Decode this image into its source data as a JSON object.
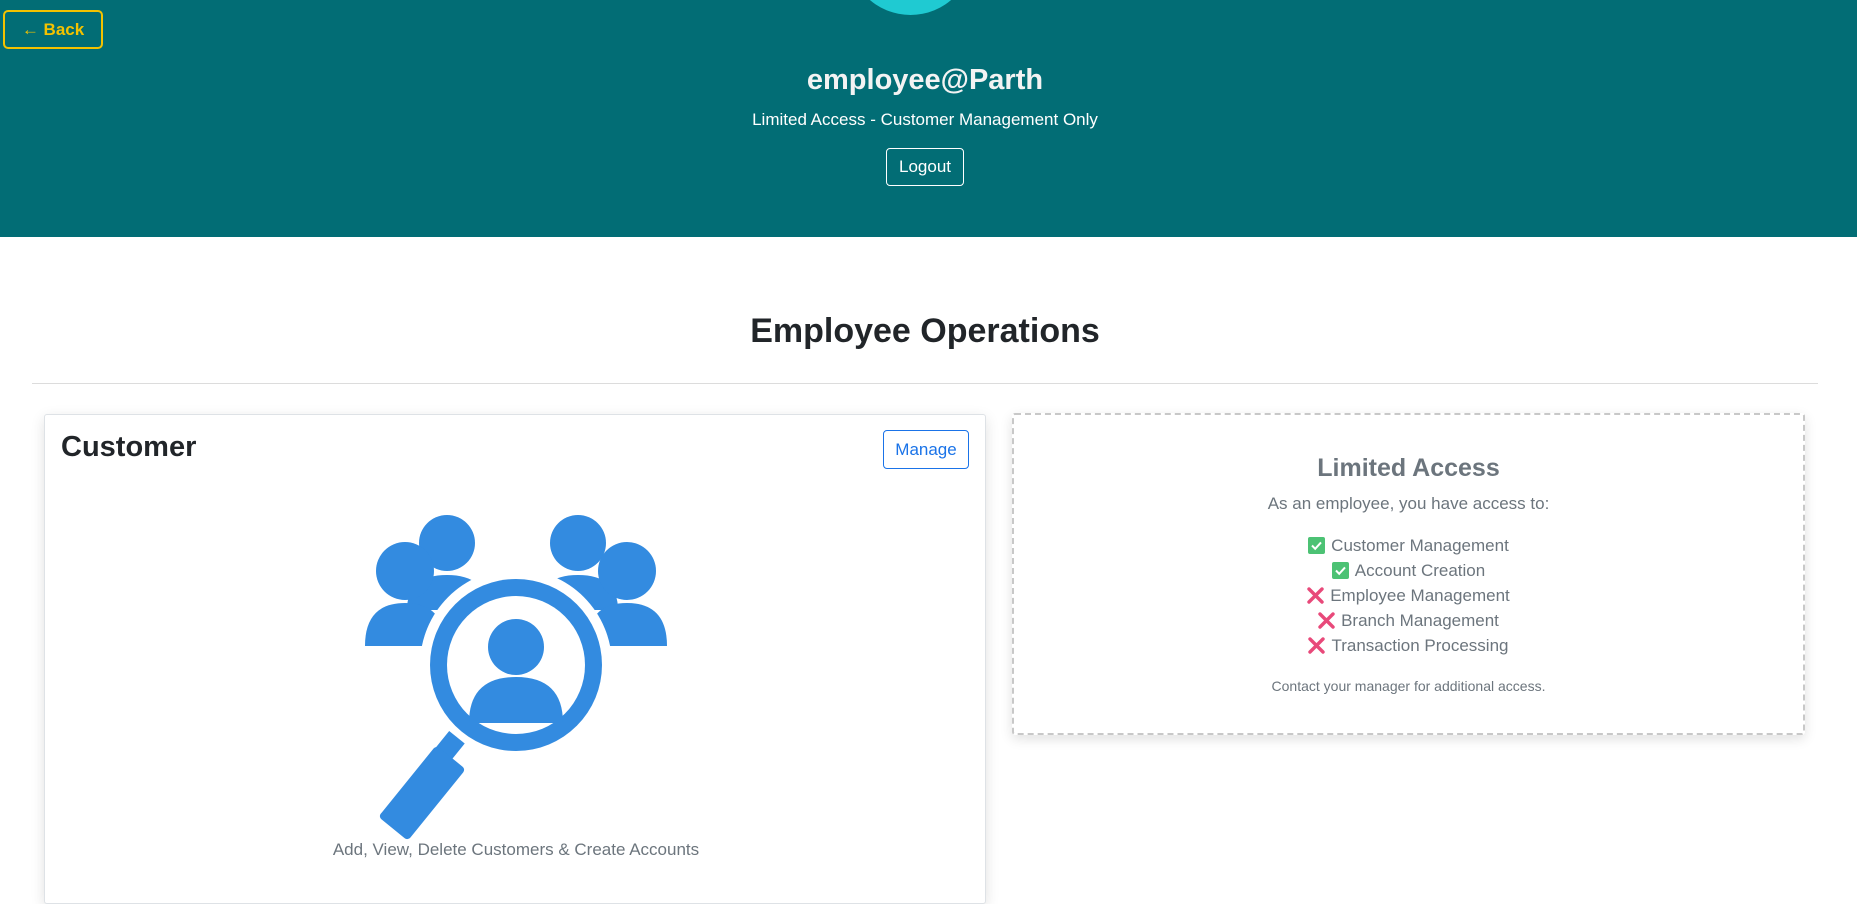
{
  "header": {
    "back_label": "← Back",
    "username": "employee@Parth",
    "subtitle": "Limited Access - Customer Management Only",
    "logout_label": "Logout"
  },
  "main": {
    "title": "Employee Operations"
  },
  "customer_card": {
    "title": "Customer",
    "manage_label": "Manage",
    "icon": "customer-search-icon",
    "description": "Add, View, Delete Customers & Create Accounts"
  },
  "access_panel": {
    "title": "Limited Access",
    "intro": "As an employee, you have access to:",
    "items": [
      {
        "label": "Customer Management",
        "allowed": true
      },
      {
        "label": "Account Creation",
        "allowed": true
      },
      {
        "label": "Employee Management",
        "allowed": false
      },
      {
        "label": "Branch Management",
        "allowed": false
      },
      {
        "label": "Transaction Processing",
        "allowed": false
      }
    ],
    "footer": "Contact your manager for additional access."
  },
  "colors": {
    "header_bg": "#026d75",
    "accent_yellow": "#f3c200",
    "primary_blue": "#1a73e8",
    "icon_blue": "#338be0",
    "check_green": "#4cc274",
    "cross_red": "#e8497a"
  }
}
